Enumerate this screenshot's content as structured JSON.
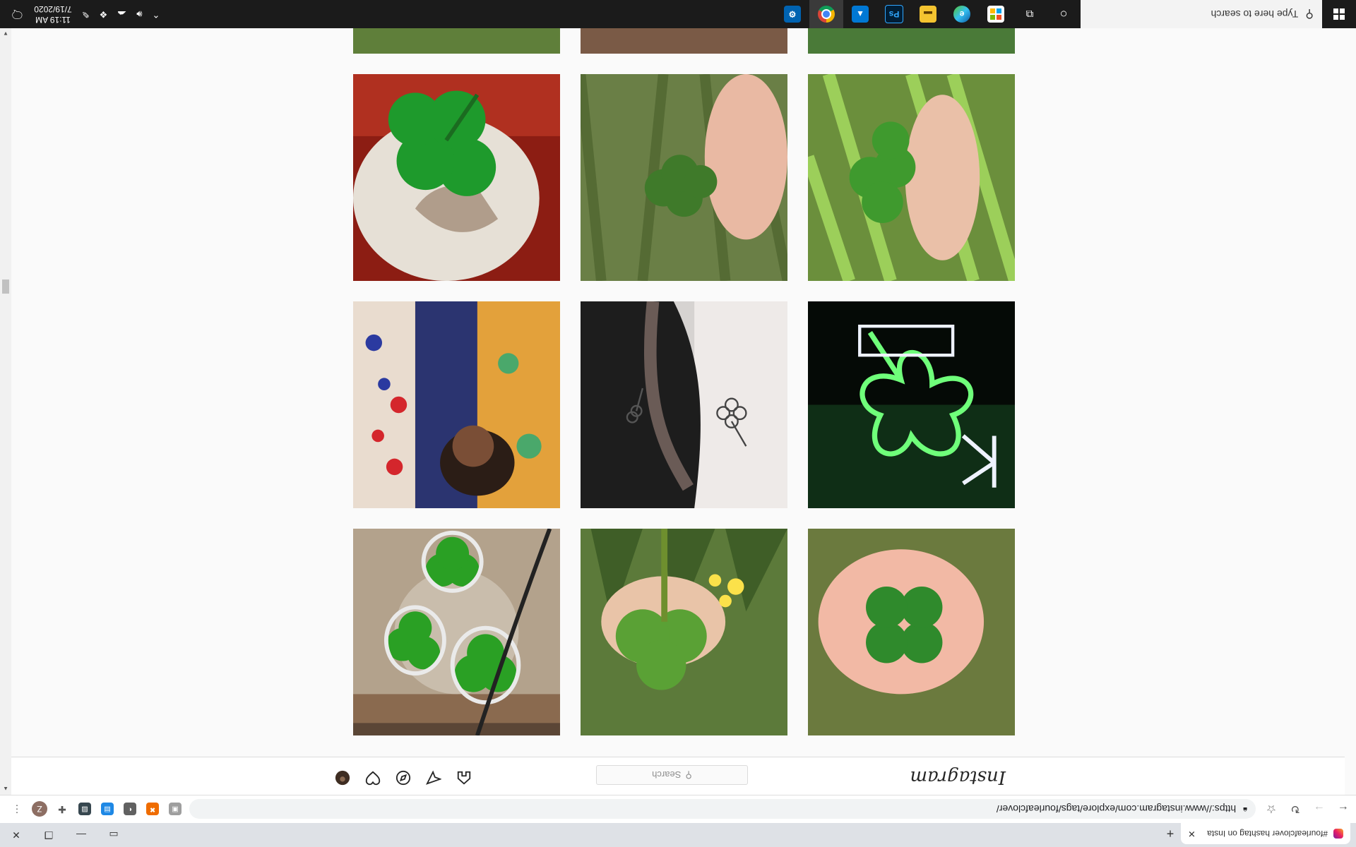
{
  "taskbar": {
    "search_placeholder": "Type here to search",
    "time": "11:19 AM",
    "date": "7/19/2020",
    "apps": [
      {
        "name": "File Explorer",
        "color": "#f4c430",
        "glyph": "▬"
      },
      {
        "name": "Store",
        "color": "#f25022",
        "glyph": "▦"
      },
      {
        "name": "Edge",
        "color": "#1e88e5",
        "glyph": "e"
      },
      {
        "name": "Photoshop",
        "color": "#001e36",
        "glyph": "Ps"
      },
      {
        "name": "Photos",
        "color": "#0078d4",
        "glyph": "▲"
      },
      {
        "name": "Chrome",
        "color": "#db4437",
        "glyph": "◉"
      },
      {
        "name": "Settings",
        "color": "#0063b1",
        "glyph": "⚙"
      }
    ]
  },
  "browser": {
    "tab_title": "#fourleafclover hashtag on Insta",
    "url": "https://www.instagram.com/explore/tags/fourleafclover/",
    "profile_initial": "Z"
  },
  "instagram": {
    "logo": "Instagram",
    "search_placeholder": "Search"
  }
}
